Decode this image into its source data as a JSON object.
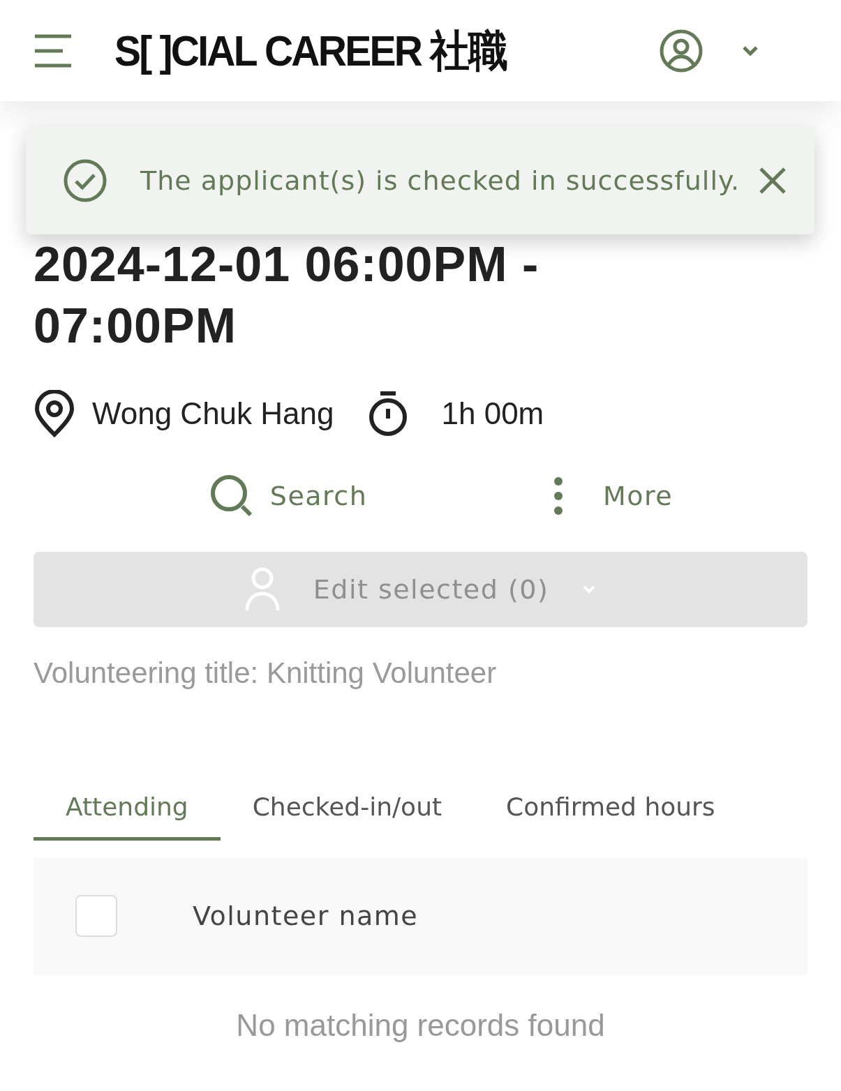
{
  "header": {
    "logo": "S[ ]CIAL CAREER 社職"
  },
  "toast": {
    "message": "The applicant(s) is checked in successfully."
  },
  "session": {
    "title": "2024-12-01 06:00PM - 07:00PM",
    "location": "Wong Chuk Hang",
    "duration": "1h 00m"
  },
  "actions": [
    {
      "kind": "search",
      "label": "Search"
    },
    {
      "kind": "more",
      "label": "More"
    }
  ],
  "edit_button": {
    "label": "Edit selected (0)",
    "disabled": true
  },
  "volunteering_title": "Volunteering title: Knitting Volunteer",
  "tabs": [
    {
      "label": "Attending",
      "selected": true
    },
    {
      "label": "Checked-in/out",
      "selected": false
    },
    {
      "label": "Confirmed hours",
      "selected": false
    }
  ],
  "table": {
    "select_all_checked": false,
    "columns": [
      "Volunteer name"
    ],
    "empty_message": "No matching records found"
  }
}
